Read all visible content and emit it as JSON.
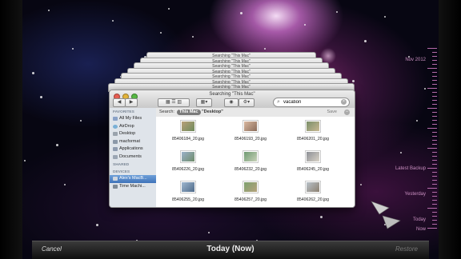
{
  "stack": {
    "window_title": "Searching \"This Mac\""
  },
  "toolbar": {
    "back_label": "◀",
    "forward_label": "▶",
    "search_value": "vacation",
    "search_placeholder": ""
  },
  "scope": {
    "label": "Search:",
    "this_mac": "This Mac",
    "desktop": "\"Desktop\"",
    "save": "Save"
  },
  "sidebar": {
    "favorites_header": "FAVORITES",
    "favorites": [
      {
        "label": "All My Files"
      },
      {
        "label": "AirDrop"
      },
      {
        "label": "Desktop"
      },
      {
        "label": "macformat"
      },
      {
        "label": "Applications"
      },
      {
        "label": "Documents"
      }
    ],
    "shared_header": "SHARED",
    "devices_header": "DEVICES",
    "devices": [
      {
        "label": "Alex's MacB..."
      },
      {
        "label": "Time Machi..."
      }
    ]
  },
  "files": [
    {
      "name": "85406184_20.jpg"
    },
    {
      "name": "85406193_20.jpg"
    },
    {
      "name": "85406201_20.jpg"
    },
    {
      "name": "85406226_20.jpg"
    },
    {
      "name": "85406232_20.jpg"
    },
    {
      "name": "85406245_20.jpg"
    },
    {
      "name": "85406255_20.jpg"
    },
    {
      "name": "85406257_20.jpg"
    },
    {
      "name": "85406262_20.jpg"
    }
  ],
  "timeline": {
    "labels": [
      "Nov 2012",
      "Latest Backup",
      "Yesterday",
      "Today",
      "Now"
    ]
  },
  "bottom": {
    "cancel": "Cancel",
    "title": "Today (Now)",
    "restore": "Restore"
  },
  "colors": {
    "accent": "#3f73b9",
    "timeline": "#b56aa9"
  }
}
